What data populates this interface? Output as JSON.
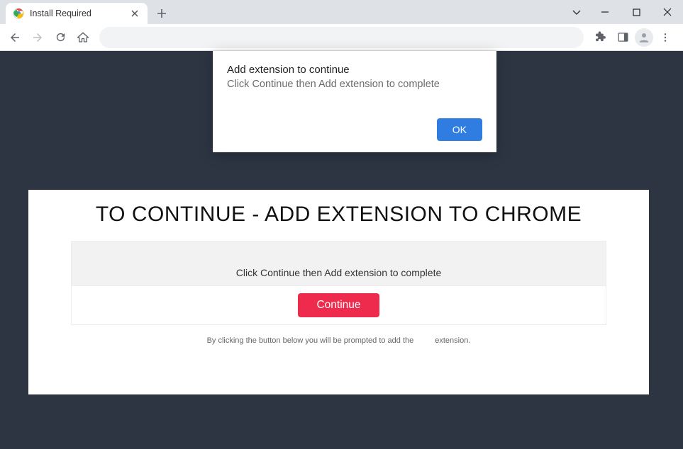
{
  "tab": {
    "title": "Install Required"
  },
  "dialog": {
    "title": "Add extension to continue",
    "text": "Click Continue then Add extension to complete",
    "ok_label": "OK"
  },
  "page": {
    "heading": "TO CONTINUE - ADD EXTENSION TO CHROME",
    "subtext": "Click Continue then Add extension to complete",
    "continue_label": "Continue",
    "disclaimer_before": "By clicking the button below you will be prompted to add the",
    "disclaimer_after": "extension."
  }
}
